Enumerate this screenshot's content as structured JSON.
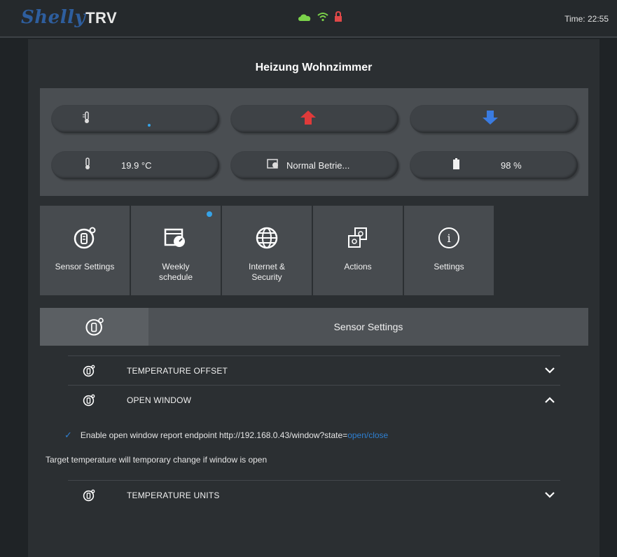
{
  "topbar": {
    "brand_script": "Shelly",
    "brand_model": "TRV",
    "time": "Time: 22:55",
    "icons": [
      "cloud-icon",
      "wifi-icon",
      "lock-icon"
    ],
    "colors": {
      "cloud": "#7bd24a",
      "wifi": "#7bd24a",
      "lock": "#e04848"
    }
  },
  "device": {
    "title": "Heizung Wohnzimmer"
  },
  "controls": {
    "target_temp_value": "",
    "temp_up_color": "#e03a3a",
    "temp_down_color": "#3a7be0",
    "current_temp": "19.9 °C",
    "mode": "Normal Betrie...",
    "battery": "98 %"
  },
  "tiles": [
    {
      "label": "Sensor Settings",
      "icon": "sensor-icon",
      "dot": false
    },
    {
      "label": "Weekly\nschedule",
      "icon": "schedule-icon",
      "dot": true
    },
    {
      "label": "Internet &\nSecurity",
      "icon": "globe-icon",
      "dot": false
    },
    {
      "label": "Actions",
      "icon": "actions-icon",
      "dot": false
    },
    {
      "label": "Settings",
      "icon": "info-icon",
      "dot": false
    }
  ],
  "section": {
    "title": "Sensor Settings"
  },
  "accordion": [
    {
      "label": "TEMPERATURE OFFSET",
      "expanded": false
    },
    {
      "label": "OPEN WINDOW",
      "expanded": true
    },
    {
      "label": "TEMPERATURE UNITS",
      "expanded": false
    }
  ],
  "open_window": {
    "checkbox_checked": true,
    "enable_text": "Enable open window report endpoint http://192.168.0.43/window?state=",
    "enable_link": "open/close",
    "info_text": "Target temperature will temporary change if window is open"
  }
}
